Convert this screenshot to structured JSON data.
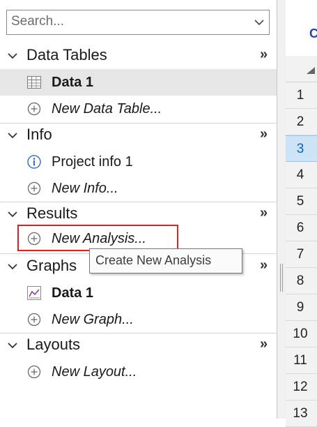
{
  "search": {
    "placeholder": "Search..."
  },
  "sections": {
    "data_tables": {
      "title": "Data Tables",
      "more": "»",
      "items": [
        {
          "label": "Data 1",
          "icon": "table-icon",
          "selected": true
        },
        {
          "label": "New Data Table...",
          "icon": "add-circle-icon"
        }
      ]
    },
    "info": {
      "title": "Info",
      "more": "»",
      "items": [
        {
          "label": "Project info 1",
          "icon": "info-icon"
        },
        {
          "label": "New Info...",
          "icon": "add-circle-icon"
        }
      ]
    },
    "results": {
      "title": "Results",
      "more": "»",
      "items": [
        {
          "label": "New Analysis...",
          "icon": "add-circle-icon"
        }
      ]
    },
    "graphs": {
      "title": "Graphs",
      "more": "»",
      "items": [
        {
          "label": "Data 1",
          "icon": "graph-icon"
        },
        {
          "label": "New Graph...",
          "icon": "add-circle-icon"
        }
      ]
    },
    "layouts": {
      "title": "Layouts",
      "more": "»",
      "items": [
        {
          "label": "New Layout...",
          "icon": "add-circle-icon"
        }
      ]
    }
  },
  "tooltip": {
    "text": "Create New Analysis"
  },
  "sheet": {
    "column_header_partial": "C",
    "active_row": 3,
    "rows": [
      "1",
      "2",
      "3",
      "4",
      "5",
      "6",
      "7",
      "8",
      "9",
      "10",
      "11",
      "12",
      "13"
    ]
  },
  "colors": {
    "highlight": "#e02020",
    "active_row": "#cde3f6",
    "accent": "#2a3fae"
  }
}
